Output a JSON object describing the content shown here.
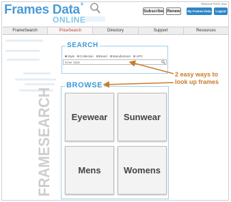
{
  "brand": {
    "logo_text": "Frames Data",
    "trademark": "®",
    "online": "ONLINE"
  },
  "header": {
    "welcome": "Welcome FDOL User",
    "subscribe_label": "Subscribe",
    "renew_label": "Renew",
    "my_frames_label": "My Frames Data",
    "logout_label": "Logout"
  },
  "nav": {
    "tabs": [
      "FrameSearch",
      "PriceSearch",
      "Directory",
      "Support",
      "Resources"
    ],
    "active": "PriceSearch"
  },
  "side_text": "FRAMESEARCH",
  "search": {
    "title": "SEARCH",
    "options": [
      "Style",
      "Collection",
      "Brand",
      "Manufacturer",
      "UPC"
    ],
    "selected": "Style",
    "placeholder": "Enter Style"
  },
  "browse": {
    "title": "BROWSE",
    "tiles": [
      "Eyewear",
      "Sunwear",
      "Mens",
      "Womens"
    ]
  },
  "annotation": {
    "line1": "2 easy ways to",
    "line2": "look up frames"
  },
  "colors": {
    "brand_blue": "#4a9bd6",
    "button_blue": "#2f86c8",
    "annotation_orange": "#c77c2c",
    "active_tab": "#c0392b"
  }
}
